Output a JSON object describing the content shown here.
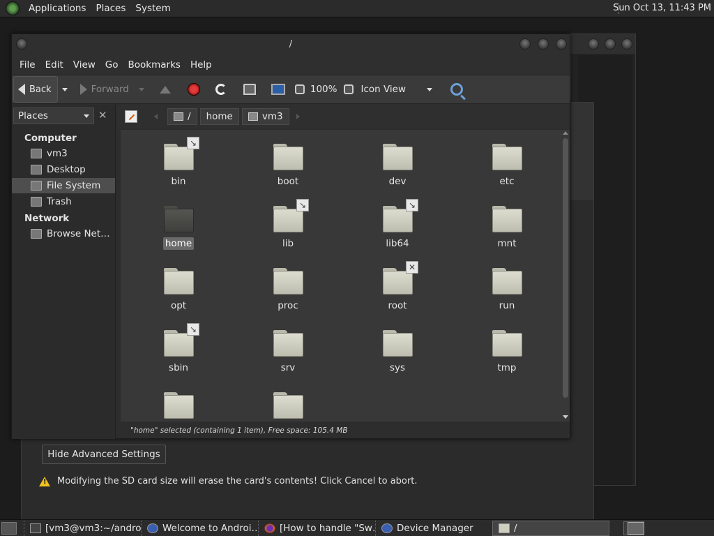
{
  "top_panel": {
    "menus": [
      "Applications",
      "Places",
      "System"
    ],
    "clock": "Sun Oct 13, 11:43 PM"
  },
  "background_dialog": {
    "hide_advanced_label": "Hide Advanced Settings",
    "warning_text": "Modifying the SD card size will erase the card's contents! Click Cancel to abort."
  },
  "file_manager": {
    "title": "/",
    "menubar": [
      "File",
      "Edit",
      "View",
      "Go",
      "Bookmarks",
      "Help"
    ],
    "toolbar": {
      "back_label": "Back",
      "forward_label": "Forward",
      "zoom_level": "100%",
      "view_mode": "Icon View"
    },
    "sidebar": {
      "combo_label": "Places",
      "close_glyph": "✕",
      "sections": [
        {
          "heading": "Computer",
          "items": [
            {
              "label": "vm3",
              "icon": "home-folder-icon",
              "selected": false
            },
            {
              "label": "Desktop",
              "icon": "desktop-folder-icon",
              "selected": false
            },
            {
              "label": "File System",
              "icon": "filesystem-icon",
              "selected": true
            },
            {
              "label": "Trash",
              "icon": "trash-icon",
              "selected": false
            }
          ]
        },
        {
          "heading": "Network",
          "items": [
            {
              "label": "Browse Net…",
              "icon": "network-icon",
              "selected": false
            }
          ]
        }
      ]
    },
    "pathbar": {
      "crumbs": [
        "/",
        "home",
        "vm3"
      ]
    },
    "folders": [
      {
        "name": "bin",
        "emblem": "symlink",
        "selected": false
      },
      {
        "name": "boot",
        "emblem": "",
        "selected": false
      },
      {
        "name": "dev",
        "emblem": "",
        "selected": false
      },
      {
        "name": "etc",
        "emblem": "",
        "selected": false
      },
      {
        "name": "home",
        "emblem": "",
        "selected": true
      },
      {
        "name": "lib",
        "emblem": "symlink",
        "selected": false
      },
      {
        "name": "lib64",
        "emblem": "symlink",
        "selected": false
      },
      {
        "name": "mnt",
        "emblem": "",
        "selected": false
      },
      {
        "name": "opt",
        "emblem": "",
        "selected": false
      },
      {
        "name": "proc",
        "emblem": "",
        "selected": false
      },
      {
        "name": "root",
        "emblem": "unreadable",
        "selected": false
      },
      {
        "name": "run",
        "emblem": "",
        "selected": false
      },
      {
        "name": "sbin",
        "emblem": "symlink",
        "selected": false
      },
      {
        "name": "srv",
        "emblem": "",
        "selected": false
      },
      {
        "name": "sys",
        "emblem": "",
        "selected": false
      },
      {
        "name": "tmp",
        "emblem": "",
        "selected": false
      },
      {
        "name": "",
        "emblem": "",
        "selected": false
      },
      {
        "name": "",
        "emblem": "",
        "selected": false
      }
    ],
    "status": "\"home\" selected (containing 1 item), Free space: 105.4 MB"
  },
  "taskbar": {
    "tasks": [
      {
        "label": "[vm3@vm3:~/andro…",
        "icon": "terminal-icon",
        "active": false
      },
      {
        "label": "Welcome to Androi…",
        "icon": "app-icon",
        "active": false
      },
      {
        "label": "[How to handle \"Sw…",
        "icon": "firefox-icon",
        "active": false
      },
      {
        "label": "Device Manager",
        "icon": "app-icon",
        "active": false
      },
      {
        "label": "/",
        "icon": "folder-icon",
        "active": true
      }
    ]
  },
  "colors": {
    "panel_bg": "#2b2b2b",
    "window_bg": "#2d2d2d",
    "content_bg": "#383838",
    "selection_bg": "#4e4e4e",
    "warning": "#f2c21e",
    "stop_red": "#e23b3b"
  }
}
